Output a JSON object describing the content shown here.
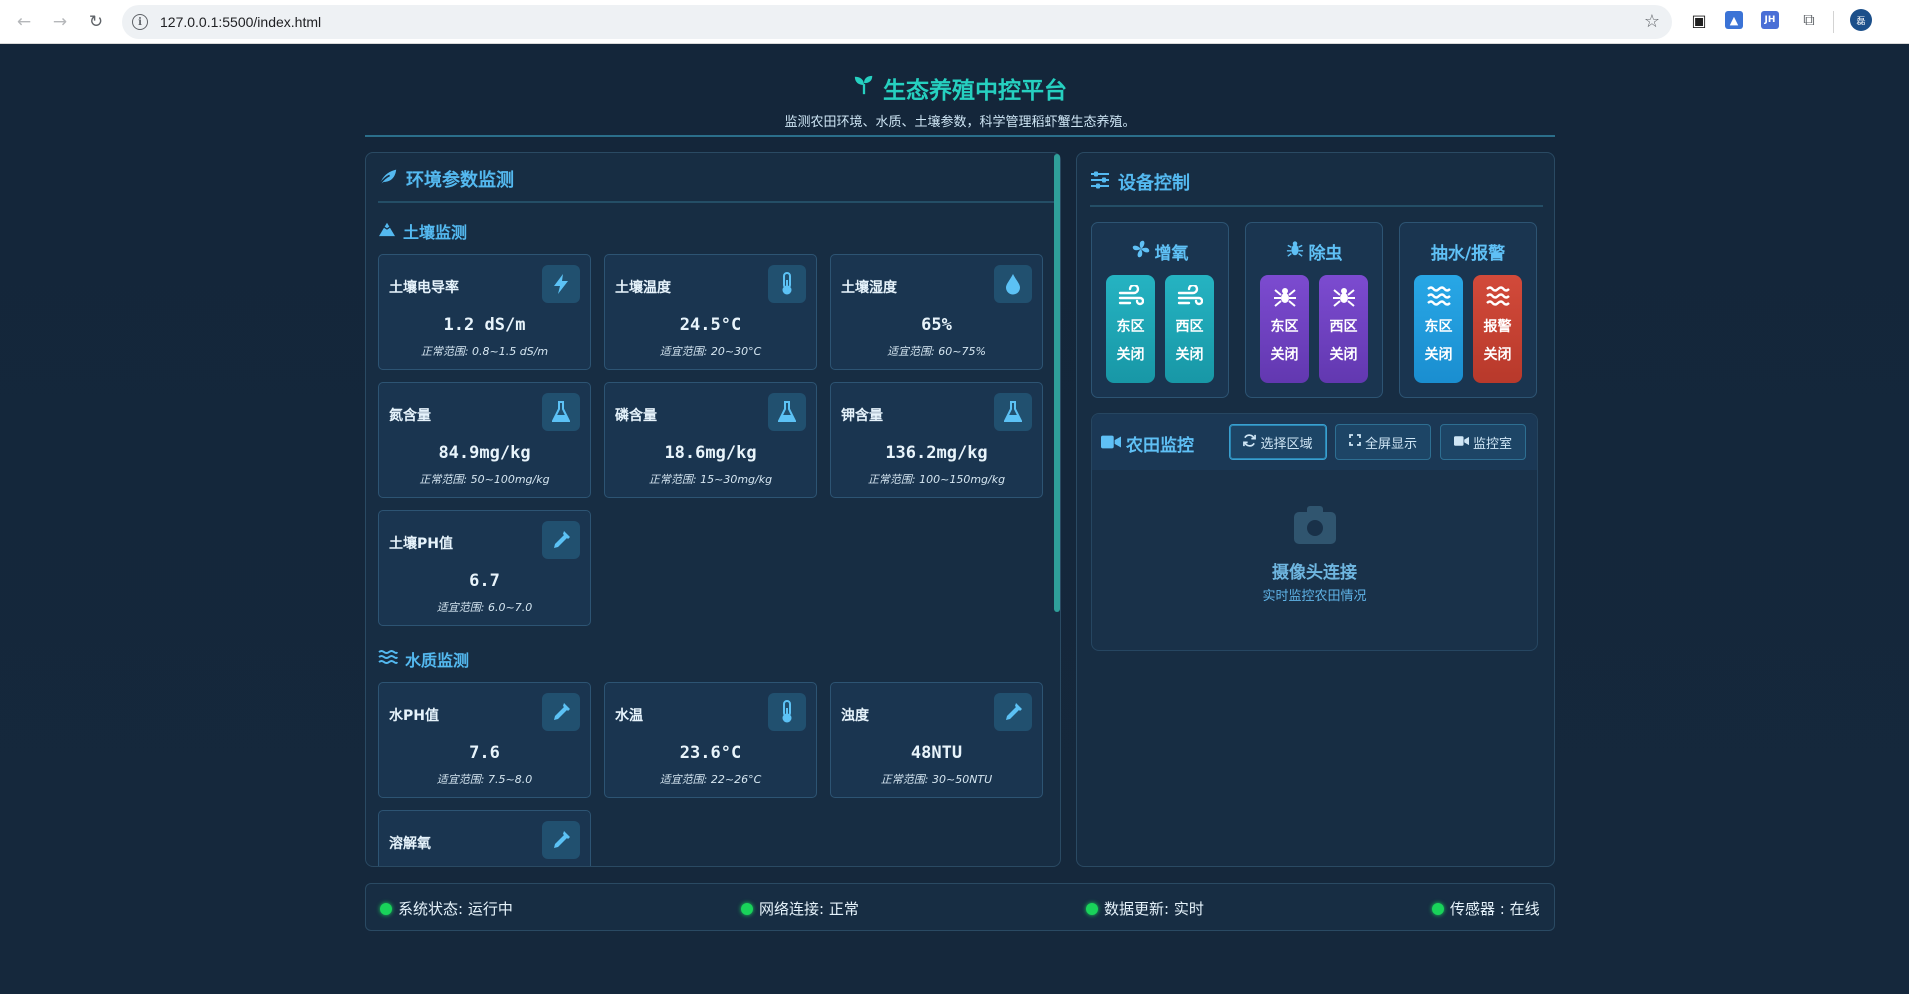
{
  "browser": {
    "url": "127.0.0.1:5500/index.html",
    "profile_initial": "磊"
  },
  "header": {
    "title": "生态养殖中控平台",
    "subtitle": "监测农田环境、水质、土壤参数，科学管理稻虾蟹生态养殖。"
  },
  "env": {
    "title": "环境参数监测",
    "soil": {
      "title": "土壤监测",
      "cards": [
        {
          "name": "土壤电导率",
          "value": "1.2 dS/m",
          "range": "正常范围: 0.8~1.5 dS/m",
          "icon": "bolt-icon"
        },
        {
          "name": "土壤温度",
          "value": "24.5°C",
          "range": "适宜范围: 20~30°C",
          "icon": "thermometer-icon"
        },
        {
          "name": "土壤湿度",
          "value": "65%",
          "range": "适宜范围: 60~75%",
          "icon": "droplet-icon"
        },
        {
          "name": "氮含量",
          "value": "84.9mg/kg",
          "range": "正常范围: 50~100mg/kg",
          "icon": "flask-icon"
        },
        {
          "name": "磷含量",
          "value": "18.6mg/kg",
          "range": "正常范围: 15~30mg/kg",
          "icon": "flask-icon"
        },
        {
          "name": "钾含量",
          "value": "136.2mg/kg",
          "range": "正常范围: 100~150mg/kg",
          "icon": "flask-icon"
        },
        {
          "name": "土壤PH值",
          "value": "6.7",
          "range": "适宜范围: 6.0~7.0",
          "icon": "eyedropper-icon"
        }
      ]
    },
    "water": {
      "title": "水质监测",
      "cards": [
        {
          "name": "水PH值",
          "value": "7.6",
          "range": "适宜范围: 7.5~8.0",
          "icon": "eyedropper-icon"
        },
        {
          "name": "水温",
          "value": "23.6°C",
          "range": "适宜范围: 22~26°C",
          "icon": "thermometer-icon"
        },
        {
          "name": "浊度",
          "value": "48NTU",
          "range": "正常范围: 30~50NTU",
          "icon": "eyedropper-icon"
        },
        {
          "name": "溶解氧",
          "value": "",
          "range": "",
          "icon": "eyedropper-icon"
        }
      ]
    }
  },
  "devices": {
    "title": "设备控制",
    "groups": [
      {
        "title": "增氧",
        "icon": "fan-icon",
        "buttons": [
          {
            "zone": "东区",
            "state": "关闭",
            "icon": "wind-icon",
            "color": "#1fa6b5"
          },
          {
            "zone": "西区",
            "state": "关闭",
            "icon": "wind-icon",
            "color": "#1fa6b5"
          }
        ]
      },
      {
        "title": "除虫",
        "icon": "bug-icon",
        "buttons": [
          {
            "zone": "东区",
            "state": "关闭",
            "icon": "spider-icon",
            "color": "#6f42c1"
          },
          {
            "zone": "西区",
            "state": "关闭",
            "icon": "spider-icon",
            "color": "#6f42c1"
          }
        ]
      },
      {
        "title": "抽水/报警",
        "icon": "",
        "buttons": [
          {
            "zone": "东区",
            "state": "关闭",
            "icon": "water-icon",
            "color": "#1d9ad9"
          },
          {
            "zone": "报警",
            "state": "关闭",
            "icon": "water-icon",
            "color": "#c64232"
          }
        ]
      }
    ]
  },
  "monitor": {
    "title": "农田监控",
    "select_area": "选择区域",
    "fullscreen": "全屏显示",
    "room": "监控室",
    "camera_label": "摄像头连接",
    "camera_sub": "实时监控农田情况"
  },
  "status": [
    {
      "label": "系统状态: 运行中"
    },
    {
      "label": "网络连接: 正常"
    },
    {
      "label": "数据更新: 实时"
    },
    {
      "label": "传感器 : 在线"
    }
  ],
  "colors": {
    "accent": "#26d0c0",
    "section_title": "#54b9f0",
    "status_dot": "#19d35a"
  }
}
